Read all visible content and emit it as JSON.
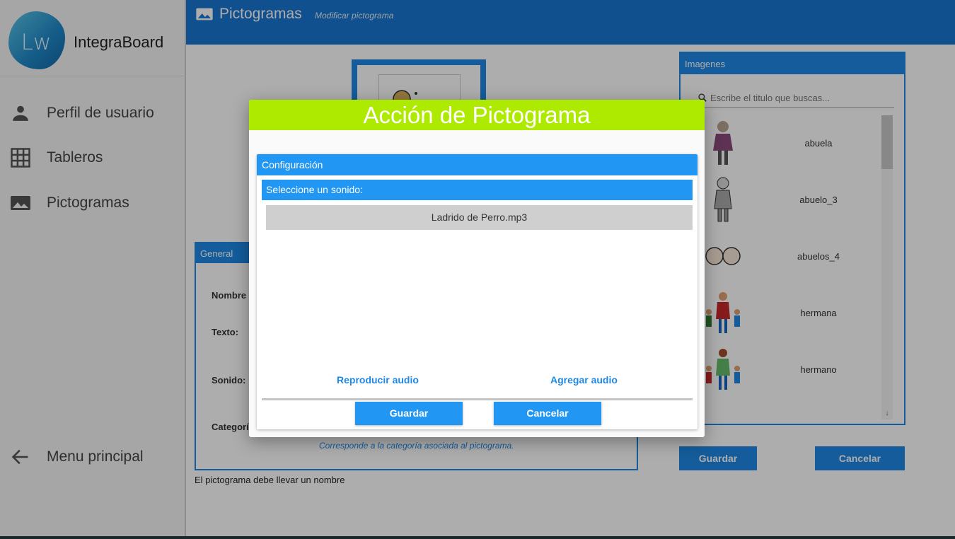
{
  "app": {
    "logo_text": "Lw",
    "name": "IntegraBoard"
  },
  "sidebar": {
    "items": [
      {
        "label": "Perfil de usuario",
        "icon": "person-icon"
      },
      {
        "label": "Tableros",
        "icon": "grid-icon"
      },
      {
        "label": "Pictogramas",
        "icon": "image-icon"
      }
    ],
    "back": {
      "label": "Menu principal",
      "icon": "arrow-left-icon"
    }
  },
  "topbar": {
    "title": "Pictogramas",
    "subtitle": "Modificar pictograma",
    "icon": "image-icon"
  },
  "general": {
    "header": "General",
    "labels": {
      "nombre": "Nombre",
      "texto": "Texto:",
      "sonido": "Sonido:",
      "categoria": "Categorí"
    },
    "category_hint": "Corresponde a la categoría asociada al pictograma."
  },
  "validation_message": "El pictograma debe llevar un nombre",
  "images": {
    "header": "Imagenes",
    "search_placeholder": "Escribe el titulo que buscas...",
    "items": [
      {
        "name": "abuela"
      },
      {
        "name": "abuelo_3"
      },
      {
        "name": "abuelos_4"
      },
      {
        "name": "hermana"
      },
      {
        "name": "hermano"
      }
    ]
  },
  "page_buttons": {
    "save": "Guardar",
    "cancel": "Cancelar"
  },
  "modal": {
    "title": "Acción de Pictograma",
    "config_header": "Configuración",
    "sound_header": "Seleccione un sonido:",
    "sounds": [
      "Ladrido de Perro.mp3"
    ],
    "play_label": "Reproducir audio",
    "add_label": "Agregar audio",
    "save_label": "Guardar",
    "cancel_label": "Cancelar"
  },
  "colors": {
    "primary": "#1e88e5",
    "topbar": "#1976d2",
    "modal_title": "#aeea00"
  }
}
